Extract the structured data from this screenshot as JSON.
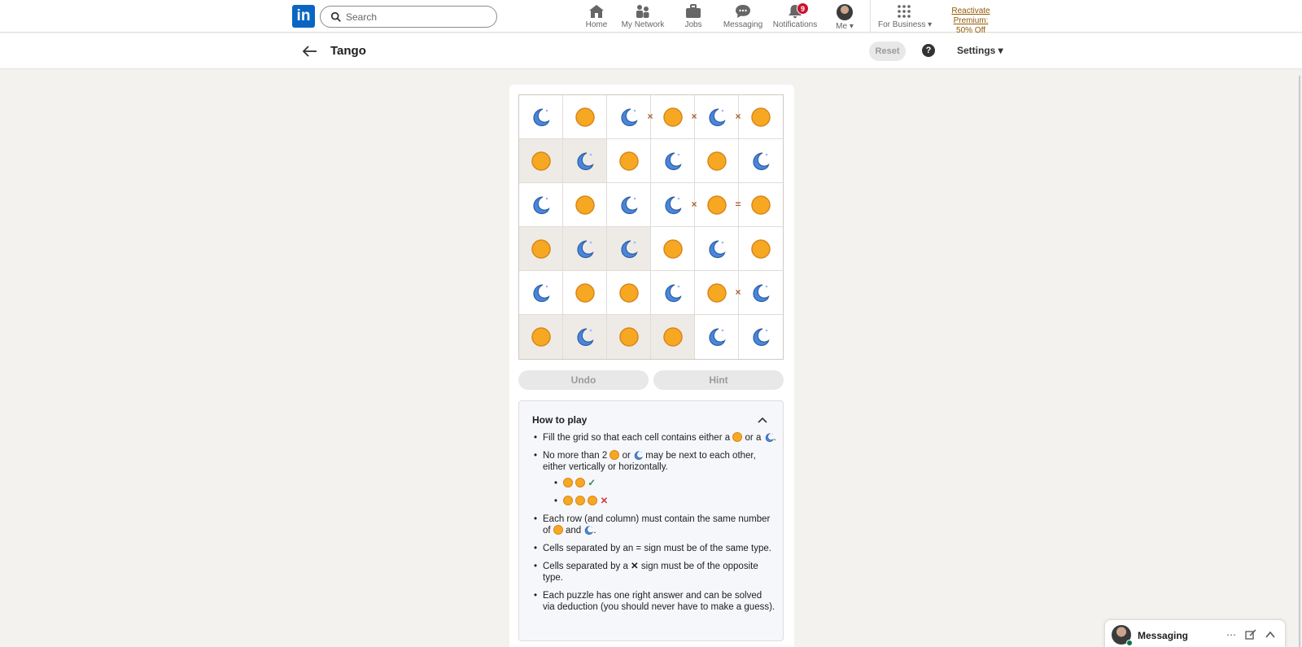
{
  "nav": {
    "logo": "in",
    "search_placeholder": "Search",
    "items": [
      {
        "label": "Home",
        "icon": "home-icon"
      },
      {
        "label": "My Network",
        "icon": "network-icon"
      },
      {
        "label": "Jobs",
        "icon": "briefcase-icon"
      },
      {
        "label": "Messaging",
        "icon": "chat-icon"
      },
      {
        "label": "Notifications",
        "icon": "bell-icon",
        "badge": "9"
      },
      {
        "label": "Me",
        "icon": "avatar"
      },
      {
        "label": "For Business",
        "icon": "grid-icon"
      }
    ],
    "premium_line1": "Reactivate Premium:",
    "premium_line2": "50% Off"
  },
  "header": {
    "title": "Tango",
    "reset": "Reset",
    "help": "?",
    "settings": "Settings"
  },
  "game": {
    "grid": [
      [
        "moon",
        "sun",
        "moon",
        "sun",
        "moon",
        "sun"
      ],
      [
        "sun",
        "moon",
        "sun",
        "moon",
        "sun",
        "moon"
      ],
      [
        "moon",
        "sun",
        "moon",
        "moon",
        "sun",
        "sun"
      ],
      [
        "sun",
        "moon",
        "moon",
        "sun",
        "moon",
        "sun"
      ],
      [
        "moon",
        "sun",
        "sun",
        "moon",
        "sun",
        "moon"
      ],
      [
        "sun",
        "moon",
        "sun",
        "sun",
        "moon",
        "moon"
      ]
    ],
    "locked": [
      [
        1,
        0
      ],
      [
        1,
        1
      ],
      [
        3,
        0
      ],
      [
        3,
        1
      ],
      [
        3,
        2
      ],
      [
        5,
        0
      ],
      [
        5,
        1
      ],
      [
        5,
        2
      ],
      [
        5,
        3
      ]
    ],
    "constraints": [
      {
        "row": 0,
        "col": 2,
        "dir": "right",
        "type": "×"
      },
      {
        "row": 0,
        "col": 3,
        "dir": "right",
        "type": "×"
      },
      {
        "row": 0,
        "col": 4,
        "dir": "right",
        "type": "×"
      },
      {
        "row": 2,
        "col": 3,
        "dir": "right",
        "type": "×"
      },
      {
        "row": 2,
        "col": 4,
        "dir": "right",
        "type": "="
      },
      {
        "row": 4,
        "col": 4,
        "dir": "right",
        "type": "×"
      }
    ],
    "undo": "Undo",
    "hint": "Hint"
  },
  "howto": {
    "title": "How to play",
    "r1a": "Fill the grid so that each cell contains either a ",
    "r1b": " or a ",
    "r1c": ".",
    "r2a": "No more than 2 ",
    "r2b": " or ",
    "r2c": " may be next to each other, either vertically or horizontally.",
    "ok_mark": "✓",
    "bad_mark": "✕",
    "r3a": "Each row (and column) must contain the same number of ",
    "r3b": " and ",
    "r3c": ".",
    "r4": "Cells separated by an = sign must be of the same type.",
    "r5a": "Cells separated by a ",
    "r5x": "✕",
    "r5b": " sign must be of the opposite type.",
    "r6": "Each puzzle has one right answer and can be solved via deduction (you should never have to make a guess)."
  },
  "dock": {
    "title": "Messaging"
  },
  "colors": {
    "linkedin_blue": "#0a66c2",
    "sun": "#f7a823",
    "moon": "#4a86d9",
    "badge": "#cb112d"
  }
}
